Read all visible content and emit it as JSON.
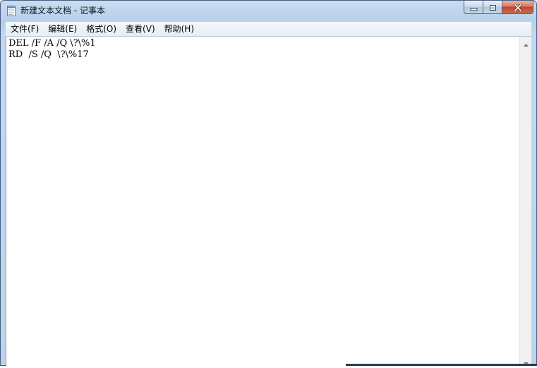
{
  "window": {
    "title": "新建文本文档 - 记事本",
    "app_icon": "notepad-icon",
    "controls": {
      "minimize_icon": "minimize-icon",
      "maximize_icon": "maximize-icon",
      "close_icon": "close-icon"
    }
  },
  "menu": {
    "items": [
      {
        "label": "文件(F)"
      },
      {
        "label": "编辑(E)"
      },
      {
        "label": "格式(O)"
      },
      {
        "label": "查看(V)"
      },
      {
        "label": "帮助(H)"
      }
    ]
  },
  "editor": {
    "content": "DEL /F /A /Q \\?\\%1\nRD  /S /Q  \\?\\%17"
  },
  "scrollbar": {
    "up_icon": "scroll-up-arrow-icon",
    "down_icon": "scroll-down-arrow-icon"
  },
  "colors": {
    "frame": "#c2d8f0",
    "close_button": "#c0452a",
    "text": "#000000"
  }
}
